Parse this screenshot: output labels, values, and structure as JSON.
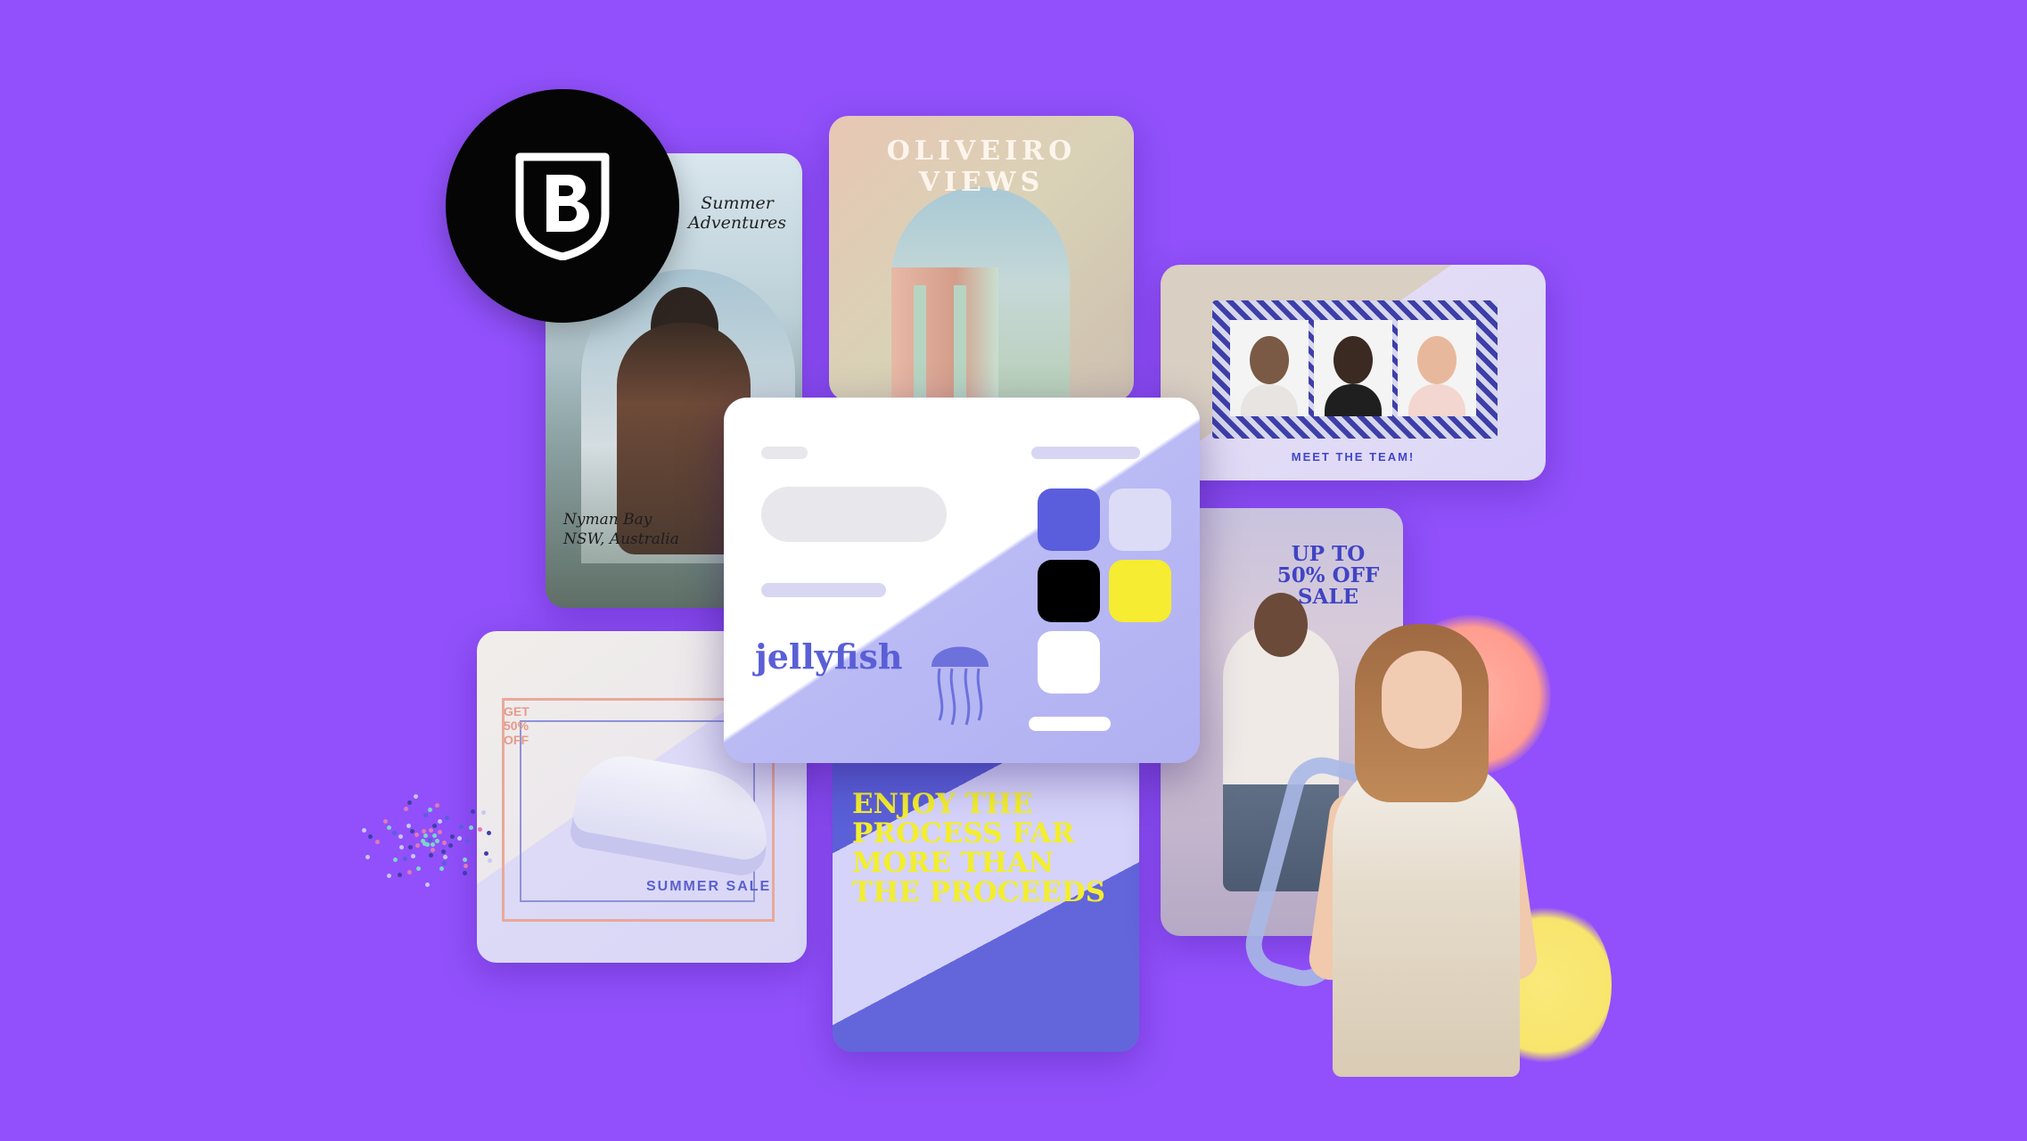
{
  "background_color": "#9150fb",
  "logo": {
    "letter": "B",
    "icon": "b-shield-logo"
  },
  "cards": {
    "beach": {
      "title": "Summer\nAdventures",
      "location": "Nyman Bay\nNSW, Australia"
    },
    "oliveiro": {
      "title": "OLIVEIRO VIEWS"
    },
    "team": {
      "caption": "MEET THE TEAM!"
    },
    "palette": {
      "brand_name": "jellyfish",
      "swatches": [
        "#5a5edc",
        "#dcdcf6",
        "#000000",
        "#f6ec31",
        "#ffffff"
      ]
    },
    "sale": {
      "promo": "GET\n50%\nOFF",
      "label": "SUMMER SALE"
    },
    "quote": {
      "text": "ENJOY THE PROCESS FAR MORE THAN THE PROCEEDS"
    },
    "fashion": {
      "promo": "UP TO\n50% OFF\nSALE"
    }
  }
}
